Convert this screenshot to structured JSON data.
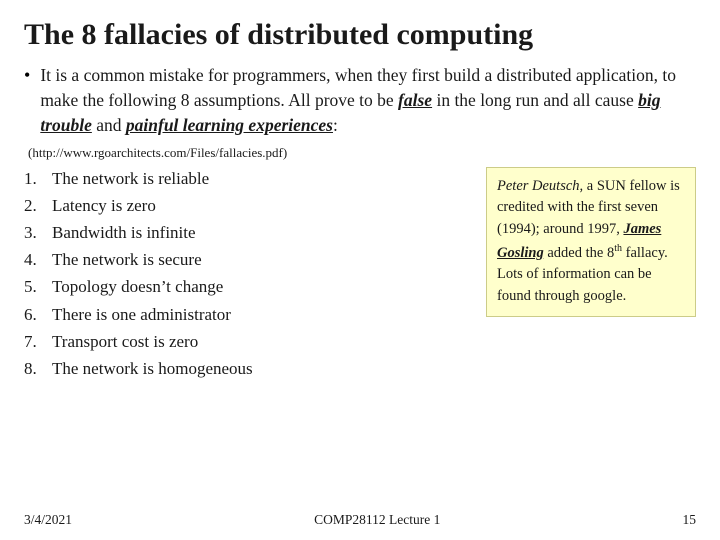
{
  "title": "The 8 fallacies of distributed computing",
  "intro": {
    "bullet": "•",
    "text_parts": [
      "It is a common mistake for programmers, when they first build a distributed application, to make the following 8 assumptions. All prove to be ",
      "false",
      " in the long run and all cause ",
      "big trouble",
      " and ",
      "painful learning experiences",
      ":"
    ]
  },
  "source": "(http://www.rgoarchitects.com/Files/fallacies.pdf)",
  "list_items": [
    {
      "num": "1.",
      "text": "The network is reliable"
    },
    {
      "num": "2.",
      "text": "Latency is zero"
    },
    {
      "num": "3.",
      "text": "Bandwidth is infinite"
    },
    {
      "num": "4.",
      "text": "The network is secure"
    },
    {
      "num": "5.",
      "text": "Topology doesn’t change"
    },
    {
      "num": "6.",
      "text": "There is one administrator"
    },
    {
      "num": "7.",
      "text": "Transport cost is zero"
    },
    {
      "num": "8.",
      "text": "The network is homogeneous"
    }
  ],
  "sidebar": {
    "part1": "Peter Deutsch,",
    "part2": " a SUN fellow is credited with the first seven (1994); around 1997, ",
    "james": "James Gosling",
    "part3": " added the 8",
    "superscript": "th",
    "part4": " fallacy.\nLots of information can be found through google."
  },
  "footer": {
    "date": "3/4/2021",
    "course": "COMP28112 Lecture 1",
    "page": "15"
  }
}
